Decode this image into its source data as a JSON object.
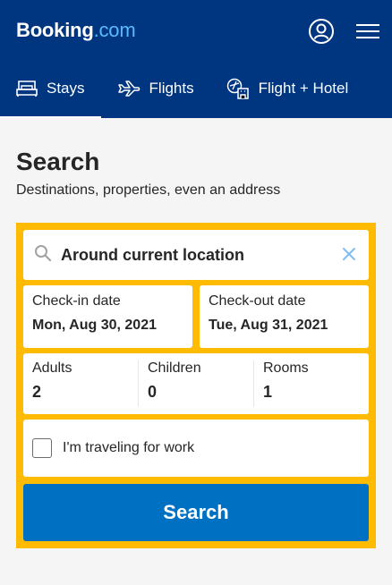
{
  "header": {
    "logo_main": "Booking",
    "logo_suffix": ".com",
    "account_icon": "user-circle-icon",
    "menu_icon": "hamburger-menu-icon",
    "tabs": [
      {
        "label": "Stays",
        "icon": "bed-icon",
        "active": true
      },
      {
        "label": "Flights",
        "icon": "plane-icon",
        "active": false
      },
      {
        "label": "Flight + Hotel",
        "icon": "plane-hotel-icon",
        "active": false
      }
    ]
  },
  "main": {
    "title": "Search",
    "subtitle": "Destinations, properties, even an address"
  },
  "form": {
    "destination": {
      "value": "Around current location",
      "icon": "search-icon",
      "clear_icon": "close-icon"
    },
    "checkin": {
      "label": "Check-in date",
      "value": "Mon, Aug 30, 2021"
    },
    "checkout": {
      "label": "Check-out date",
      "value": "Tue, Aug 31, 2021"
    },
    "guests": [
      {
        "label": "Adults",
        "value": "2"
      },
      {
        "label": "Children",
        "value": "0"
      },
      {
        "label": "Rooms",
        "value": "1"
      }
    ],
    "work_travel": {
      "label": "I'm traveling for work",
      "checked": false
    },
    "search_button": "Search"
  },
  "colors": {
    "brand_blue": "#003580",
    "accent_yellow": "#febb02",
    "button_blue": "#0071c2",
    "logo_dotcom": "#5bbaff"
  }
}
